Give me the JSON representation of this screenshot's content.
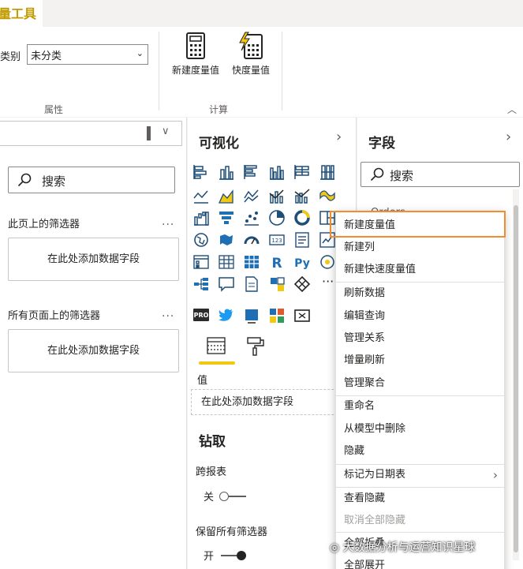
{
  "ribbon": {
    "tab_label": "度量工具",
    "category_label": "数据类别",
    "category_value": "未分类",
    "properties_group": "属性",
    "calc_group": "计算",
    "new_measure": "新建度量值",
    "quick_measure": "快度量值"
  },
  "filters": {
    "search_placeholder": "搜索",
    "page_filters_title": "此页上的筛选器",
    "all_pages_title": "所有页面上的筛选器",
    "more_dots": "...",
    "add_field_1": "在此处添加数据字段",
    "add_field_2": "在此处添加数据字段"
  },
  "viz": {
    "title": "可视化",
    "value_label": "值",
    "value_well": "在此处添加数据字段",
    "drill_title": "钻取",
    "cross_report_label": "跨报表",
    "cross_report_state": "关",
    "keep_filters_label": "保留所有筛选器",
    "keep_filters_state": "开",
    "more_glyph": "···"
  },
  "fields": {
    "title": "字段",
    "search_placeholder": "搜索",
    "table_peek": "Orders"
  },
  "context_menu": {
    "items": [
      {
        "label": "新建度量值"
      },
      {
        "label": "新建列"
      },
      {
        "label": "新建快速度量值"
      },
      {
        "label": "刷新数据"
      },
      {
        "label": "编辑查询"
      },
      {
        "label": "管理关系"
      },
      {
        "label": "增量刷新"
      },
      {
        "label": "管理聚合"
      },
      {
        "label": "重命名"
      },
      {
        "label": "从模型中删除"
      },
      {
        "label": "隐藏"
      },
      {
        "label": "标记为日期表"
      },
      {
        "label": "查看隐藏"
      },
      {
        "label": "取消全部隐藏"
      },
      {
        "label": "全部折叠"
      },
      {
        "label": "全部展开"
      }
    ]
  },
  "watermark": "大数据分析与运营知识星球",
  "colors": {
    "accent_yellow": "#f2c811",
    "highlight_orange": "#f28c33",
    "ribbon_tab_text": "#c19c00"
  }
}
